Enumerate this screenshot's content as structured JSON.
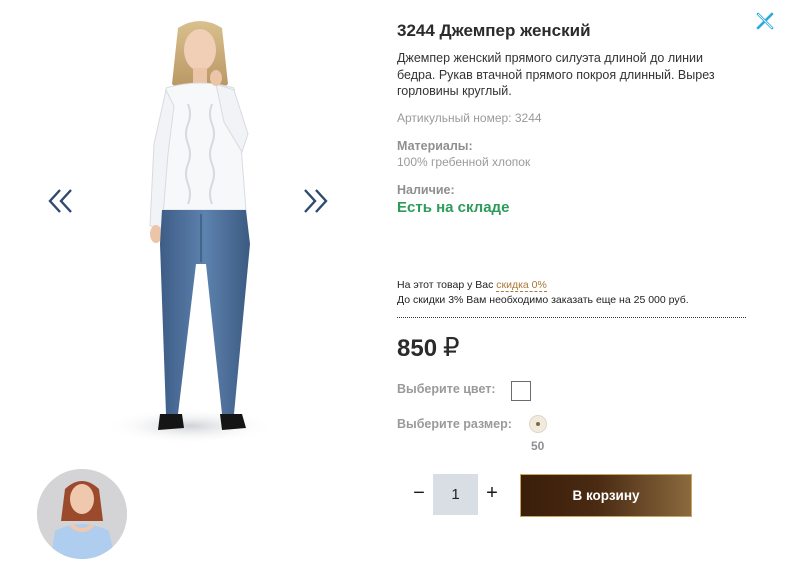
{
  "product": {
    "title": "3244 Джемпер женский",
    "description": "Джемпер женский прямого силуэта длиной до линии бедра. Рукав втачной прямого покроя длинный. Вырез горловины круглый.",
    "sku": "Артикульный номер: 3244",
    "materials_label": "Материалы:",
    "materials_value": "100% гребенной хлопок",
    "availability_label": "Наличие:",
    "availability_value": "Есть на складе"
  },
  "discount": {
    "line1_prefix": "На этот товар у Вас ",
    "line1_link": "скидка 0%",
    "line2": "До скидки 3% Вам необходимо заказать еще на 25 000 руб."
  },
  "price": {
    "amount": "850",
    "currency": "₽"
  },
  "options": {
    "color_label": "Выберите цвет:",
    "size_label": "Выберите размер:",
    "size_value": "50",
    "size_selected": true
  },
  "cart": {
    "minus": "−",
    "plus": "+",
    "quantity": "1",
    "button_label": "В корзину"
  },
  "icons": {
    "close": "close-icon",
    "prev": "chevron-double-left-icon",
    "next": "chevron-double-right-icon"
  },
  "colors": {
    "accent_green": "#2e9b5a",
    "close_blue": "#2aa9e0",
    "arrow": "#2e4a6e",
    "link": "#a8783a",
    "cart_button_dark": "#3a1e0a",
    "cart_button_gold": "#c9a65c"
  }
}
